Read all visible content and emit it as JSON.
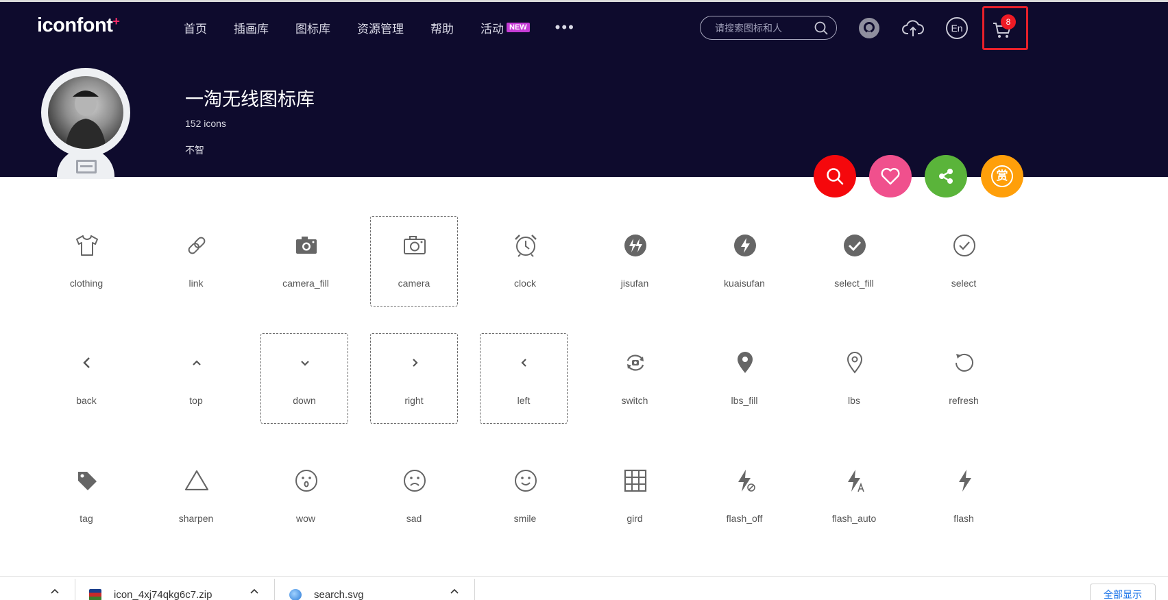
{
  "header": {
    "logo": "iconfont",
    "logo_plus": "+",
    "nav": [
      "首页",
      "插画库",
      "图标库",
      "资源管理",
      "帮助",
      "活动"
    ],
    "new_badge": "NEW",
    "more": "•••",
    "search_placeholder": "请搜索图标和人",
    "lang": "En",
    "cart_count": "8"
  },
  "profile": {
    "title": "一淘无线图标库",
    "count": "152 icons",
    "author": "不智"
  },
  "actions": {
    "colors": [
      "#f5080c",
      "#f0508d",
      "#5ab43a",
      "#ff9f0a"
    ],
    "icons": [
      "search-icon",
      "heart-icon",
      "share-icon",
      "reward-icon"
    ],
    "reward_char": "赏"
  },
  "icons": [
    [
      {
        "label": "clothing",
        "icon": "clothing-icon"
      },
      {
        "label": "link",
        "icon": "link-icon"
      },
      {
        "label": "camera_fill",
        "icon": "camera-fill-icon"
      },
      {
        "label": "camera",
        "icon": "camera-icon",
        "highlight": true
      },
      {
        "label": "clock",
        "icon": "clock-icon"
      },
      {
        "label": "jisufan",
        "icon": "jisufan-icon"
      },
      {
        "label": "kuaisufan",
        "icon": "kuaisufan-icon"
      },
      {
        "label": "select_fill",
        "icon": "select-fill-icon"
      },
      {
        "label": "select",
        "icon": "select-icon"
      }
    ],
    [
      {
        "label": "back",
        "icon": "back-icon"
      },
      {
        "label": "top",
        "icon": "top-icon"
      },
      {
        "label": "down",
        "icon": "down-icon",
        "highlight": true
      },
      {
        "label": "right",
        "icon": "right-icon",
        "highlight": true
      },
      {
        "label": "left",
        "icon": "left-icon",
        "highlight": true
      },
      {
        "label": "switch",
        "icon": "switch-icon"
      },
      {
        "label": "lbs_fill",
        "icon": "lbs-fill-icon"
      },
      {
        "label": "lbs",
        "icon": "lbs-icon"
      },
      {
        "label": "refresh",
        "icon": "refresh-icon"
      }
    ],
    [
      {
        "label": "tag",
        "icon": "tag-icon"
      },
      {
        "label": "sharpen",
        "icon": "sharpen-icon"
      },
      {
        "label": "wow",
        "icon": "wow-icon"
      },
      {
        "label": "sad",
        "icon": "sad-icon"
      },
      {
        "label": "smile",
        "icon": "smile-icon"
      },
      {
        "label": "gird",
        "icon": "grid-icon"
      },
      {
        "label": "flash_off",
        "icon": "flash-off-icon"
      },
      {
        "label": "flash_auto",
        "icon": "flash-auto-icon"
      },
      {
        "label": "flash",
        "icon": "flash-icon"
      }
    ]
  ],
  "downloads": {
    "files": [
      "icon_4xj74qkg6c7.zip",
      "search.svg"
    ],
    "show_all": "全部显示"
  }
}
